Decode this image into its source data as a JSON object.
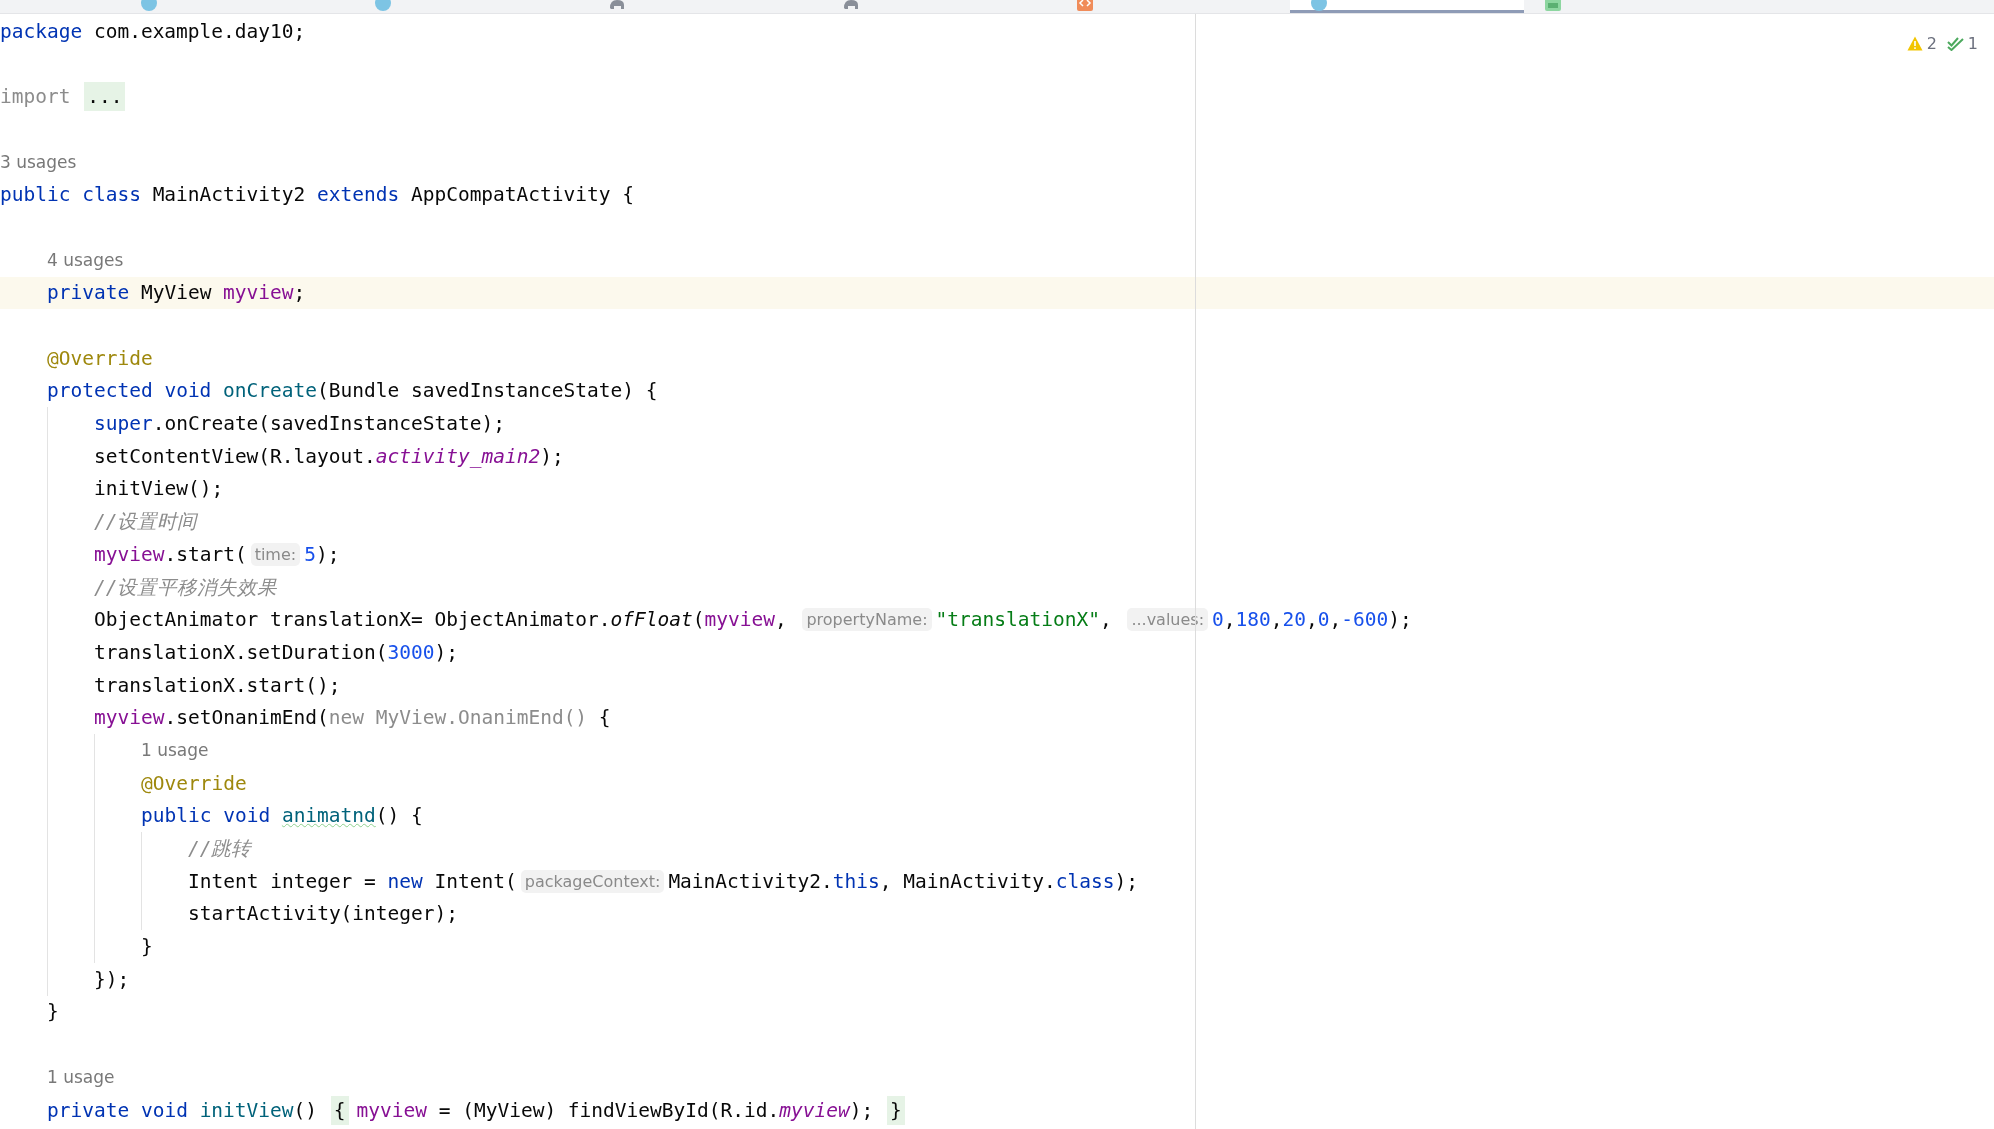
{
  "tabs": [
    {
      "kind": "java",
      "selected": false
    },
    {
      "kind": "java",
      "selected": false
    },
    {
      "kind": "gradle",
      "selected": false
    },
    {
      "kind": "gradle",
      "selected": false
    },
    {
      "kind": "xml",
      "selected": false
    },
    {
      "kind": "java",
      "selected": true
    },
    {
      "kind": "manifest",
      "selected": false
    }
  ],
  "inspections": {
    "warnings": "2",
    "checks": "1"
  },
  "lines": [
    {
      "current": false,
      "segments": [
        {
          "kind": "code",
          "tokens": [
            {
              "kind": "kw",
              "text": "package"
            },
            {
              "kind": "plain",
              "text": " com.example.day10;"
            }
          ]
        }
      ]
    },
    {
      "current": false
    },
    {
      "current": false,
      "segments": [
        {
          "kind": "code",
          "tokens": [
            {
              "kind": "dim",
              "text": "import "
            }
          ]
        },
        {
          "kind": "fold",
          "text": "..."
        }
      ]
    },
    {
      "current": false
    },
    {
      "current": false,
      "segments": [
        {
          "kind": "usage",
          "text": "3 usages"
        }
      ]
    },
    {
      "current": false,
      "segments": [
        {
          "kind": "code",
          "tokens": [
            {
              "kind": "kw",
              "text": "public class"
            },
            {
              "kind": "plain",
              "text": " MainActivity2 "
            },
            {
              "kind": "kw",
              "text": "extends"
            },
            {
              "kind": "plain",
              "text": " AppCompatActivity {"
            }
          ]
        }
      ],
      "children": [
        {
          "current": false
        },
        {
          "current": false,
          "segments": [
            {
              "kind": "usage",
              "text": "4 usages"
            }
          ]
        },
        {
          "current": true,
          "segments": [
            {
              "kind": "code",
              "tokens": [
                {
                  "kind": "kw",
                  "text": "private"
                },
                {
                  "kind": "plain",
                  "text": " MyView "
                },
                {
                  "kind": "field",
                  "text": "myview"
                },
                {
                  "kind": "plain",
                  "text": ";"
                }
              ]
            }
          ]
        },
        {
          "current": false
        },
        {
          "current": false,
          "segments": [
            {
              "kind": "code",
              "tokens": [
                {
                  "kind": "annot",
                  "text": "@Override"
                }
              ]
            }
          ]
        },
        {
          "current": false,
          "segments": [
            {
              "kind": "code",
              "tokens": [
                {
                  "kind": "kw",
                  "text": "protected void "
                },
                {
                  "kind": "decl",
                  "text": "onCreate"
                },
                {
                  "kind": "plain",
                  "text": "(Bundle savedInstanceState) {"
                }
              ]
            }
          ],
          "children": [
            {
              "current": false,
              "segments": [
                {
                  "kind": "code",
                  "tokens": [
                    {
                      "kind": "kw",
                      "text": "super"
                    },
                    {
                      "kind": "plain",
                      "text": ".onCreate(savedInstanceState);"
                    }
                  ]
                }
              ]
            },
            {
              "current": false,
              "segments": [
                {
                  "kind": "code",
                  "tokens": [
                    {
                      "kind": "plain",
                      "text": "setContentView(R.layout."
                    },
                    {
                      "kind": "static",
                      "text": "activity_main2"
                    },
                    {
                      "kind": "plain",
                      "text": ");"
                    }
                  ]
                }
              ]
            },
            {
              "current": false,
              "segments": [
                {
                  "kind": "code",
                  "tokens": [
                    {
                      "kind": "plain",
                      "text": "initView();"
                    }
                  ]
                }
              ]
            },
            {
              "current": false,
              "segments": [
                {
                  "kind": "code",
                  "tokens": [
                    {
                      "kind": "comment",
                      "text": "//设置时间"
                    }
                  ]
                }
              ]
            },
            {
              "current": false,
              "segments": [
                {
                  "kind": "code",
                  "tokens": [
                    {
                      "kind": "field",
                      "text": "myview"
                    },
                    {
                      "kind": "plain",
                      "text": ".start("
                    }
                  ]
                },
                {
                  "kind": "hint",
                  "text": "time:"
                },
                {
                  "kind": "code",
                  "tokens": [
                    {
                      "kind": "num",
                      "text": "5"
                    },
                    {
                      "kind": "plain",
                      "text": ");"
                    }
                  ]
                }
              ]
            },
            {
              "current": false,
              "segments": [
                {
                  "kind": "code",
                  "tokens": [
                    {
                      "kind": "comment",
                      "text": "//设置平移消失效果"
                    }
                  ]
                }
              ]
            },
            {
              "current": false,
              "segments": [
                {
                  "kind": "code",
                  "tokens": [
                    {
                      "kind": "plain",
                      "text": "ObjectAnimator translationX= ObjectAnimator."
                    },
                    {
                      "kind": "scall",
                      "text": "ofFloat"
                    },
                    {
                      "kind": "plain",
                      "text": "("
                    },
                    {
                      "kind": "field",
                      "text": "myview"
                    },
                    {
                      "kind": "plain",
                      "text": ", "
                    }
                  ]
                },
                {
                  "kind": "hint",
                  "text": "propertyName:"
                },
                {
                  "kind": "code",
                  "tokens": [
                    {
                      "kind": "str",
                      "text": "\"translationX\""
                    },
                    {
                      "kind": "plain",
                      "text": ", "
                    }
                  ]
                },
                {
                  "kind": "hint",
                  "text": "...values:"
                },
                {
                  "kind": "code",
                  "tokens": [
                    {
                      "kind": "num",
                      "text": "0"
                    },
                    {
                      "kind": "plain",
                      "text": ","
                    },
                    {
                      "kind": "num",
                      "text": "180"
                    },
                    {
                      "kind": "plain",
                      "text": ","
                    },
                    {
                      "kind": "num",
                      "text": "20"
                    },
                    {
                      "kind": "plain",
                      "text": ","
                    },
                    {
                      "kind": "num",
                      "text": "0"
                    },
                    {
                      "kind": "plain",
                      "text": ","
                    },
                    {
                      "kind": "num",
                      "text": "-600"
                    },
                    {
                      "kind": "plain",
                      "text": ");"
                    }
                  ]
                }
              ]
            },
            {
              "current": false,
              "segments": [
                {
                  "kind": "code",
                  "tokens": [
                    {
                      "kind": "plain",
                      "text": "translationX.setDuration("
                    },
                    {
                      "kind": "num",
                      "text": "3000"
                    },
                    {
                      "kind": "plain",
                      "text": ");"
                    }
                  ]
                }
              ]
            },
            {
              "current": false,
              "segments": [
                {
                  "kind": "code",
                  "tokens": [
                    {
                      "kind": "plain",
                      "text": "translationX.start();"
                    }
                  ]
                }
              ]
            },
            {
              "current": false,
              "segments": [
                {
                  "kind": "code",
                  "tokens": [
                    {
                      "kind": "field",
                      "text": "myview"
                    },
                    {
                      "kind": "plain",
                      "text": ".setOnanimEnd("
                    },
                    {
                      "kind": "dim",
                      "text": "new MyView.OnanimEnd()"
                    },
                    {
                      "kind": "plain",
                      "text": " {"
                    }
                  ]
                }
              ],
              "children": [
                {
                  "current": false,
                  "segments": [
                    {
                      "kind": "usage",
                      "text": "1 usage"
                    }
                  ]
                },
                {
                  "current": false,
                  "segments": [
                    {
                      "kind": "code",
                      "tokens": [
                        {
                          "kind": "annot",
                          "text": "@Override"
                        }
                      ]
                    }
                  ]
                },
                {
                  "current": false,
                  "segments": [
                    {
                      "kind": "code",
                      "tokens": [
                        {
                          "kind": "kw",
                          "text": "public void "
                        },
                        {
                          "kind": "typo",
                          "text": "animatnd"
                        },
                        {
                          "kind": "plain",
                          "text": "() {"
                        }
                      ]
                    }
                  ],
                  "children": [
                    {
                      "current": false,
                      "segments": [
                        {
                          "kind": "code",
                          "tokens": [
                            {
                              "kind": "comment",
                              "text": "//跳转"
                            }
                          ]
                        }
                      ]
                    },
                    {
                      "current": false,
                      "segments": [
                        {
                          "kind": "code",
                          "tokens": [
                            {
                              "kind": "plain",
                              "text": "Intent integer = "
                            },
                            {
                              "kind": "kw",
                              "text": "new"
                            },
                            {
                              "kind": "plain",
                              "text": " Intent("
                            }
                          ]
                        },
                        {
                          "kind": "hint",
                          "text": "packageContext:"
                        },
                        {
                          "kind": "code",
                          "tokens": [
                            {
                              "kind": "plain",
                              "text": "MainActivity2."
                            },
                            {
                              "kind": "kw",
                              "text": "this"
                            },
                            {
                              "kind": "plain",
                              "text": ", MainActivity."
                            },
                            {
                              "kind": "kw",
                              "text": "class"
                            },
                            {
                              "kind": "plain",
                              "text": ");"
                            }
                          ]
                        }
                      ]
                    },
                    {
                      "current": false,
                      "segments": [
                        {
                          "kind": "code",
                          "tokens": [
                            {
                              "kind": "plain",
                              "text": "startActivity(integer);"
                            }
                          ]
                        }
                      ]
                    }
                  ]
                },
                {
                  "current": false,
                  "segments": [
                    {
                      "kind": "code",
                      "tokens": [
                        {
                          "kind": "plain",
                          "text": "}"
                        }
                      ]
                    }
                  ]
                }
              ]
            },
            {
              "current": false,
              "segments": [
                {
                  "kind": "code",
                  "tokens": [
                    {
                      "kind": "plain",
                      "text": "});"
                    }
                  ]
                }
              ]
            }
          ]
        },
        {
          "current": false,
          "segments": [
            {
              "kind": "code",
              "tokens": [
                {
                  "kind": "plain",
                  "text": "}"
                }
              ]
            }
          ]
        },
        {
          "current": false
        },
        {
          "current": false,
          "segments": [
            {
              "kind": "usage",
              "text": "1 usage"
            }
          ]
        },
        {
          "current": false,
          "segments": [
            {
              "kind": "code",
              "tokens": [
                {
                  "kind": "kw",
                  "text": "private void "
                },
                {
                  "kind": "decl",
                  "text": "initView"
                },
                {
                  "kind": "plain",
                  "text": "() "
                }
              ]
            },
            {
              "kind": "fold",
              "text": "{"
            },
            {
              "kind": "code",
              "tokens": [
                {
                  "kind": "field",
                  "text": "myview"
                },
                {
                  "kind": "plain",
                  "text": " = (MyView) findViewById(R.id."
                },
                {
                  "kind": "static",
                  "text": "myview"
                },
                {
                  "kind": "plain",
                  "text": "); "
                }
              ]
            },
            {
              "kind": "fold",
              "text": "}"
            }
          ]
        }
      ]
    }
  ]
}
